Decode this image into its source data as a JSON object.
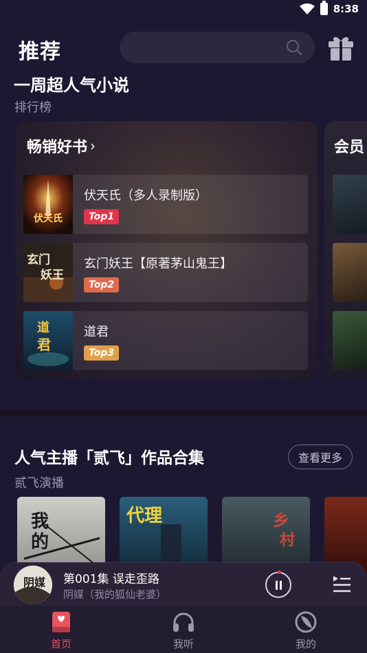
{
  "status_bar": {
    "time": "8:38"
  },
  "header": {
    "title": "推荐",
    "search_placeholder": ""
  },
  "weekly": {
    "title": "一周超人气小说",
    "subtitle": "排行榜",
    "bestseller": {
      "heading": "畅销好书",
      "items": [
        {
          "title": "伏天氏（多人录制版）",
          "badge": "Top1",
          "cover_text": "伏天氏"
        },
        {
          "title": "玄门妖王【原著茅山鬼王】",
          "badge": "Top2",
          "cover_text": "玄门妖王"
        },
        {
          "title": "道君",
          "badge": "Top3",
          "cover_text": "道君"
        }
      ]
    },
    "member": {
      "heading": "会员"
    }
  },
  "anchor": {
    "title": "人气主播「贰飞」作品合集",
    "subtitle": "贰飞演播",
    "more_label": "查看更多"
  },
  "player": {
    "title": "第001集 误走歪路",
    "subtitle": "阴媒（我的狐仙老婆）",
    "cover_text": "阴媒"
  },
  "nav": {
    "items": [
      {
        "label": "首页",
        "icon": "book-icon",
        "active": true
      },
      {
        "label": "我听",
        "icon": "headphones-icon",
        "active": false
      },
      {
        "label": "我的",
        "icon": "planet-icon",
        "active": false
      }
    ]
  },
  "colors": {
    "accent": "#e8535e",
    "background": "#1d1832",
    "badge_top1": "#e0354a",
    "badge_top2": "#e06a4c",
    "badge_top3": "#e0a048"
  }
}
